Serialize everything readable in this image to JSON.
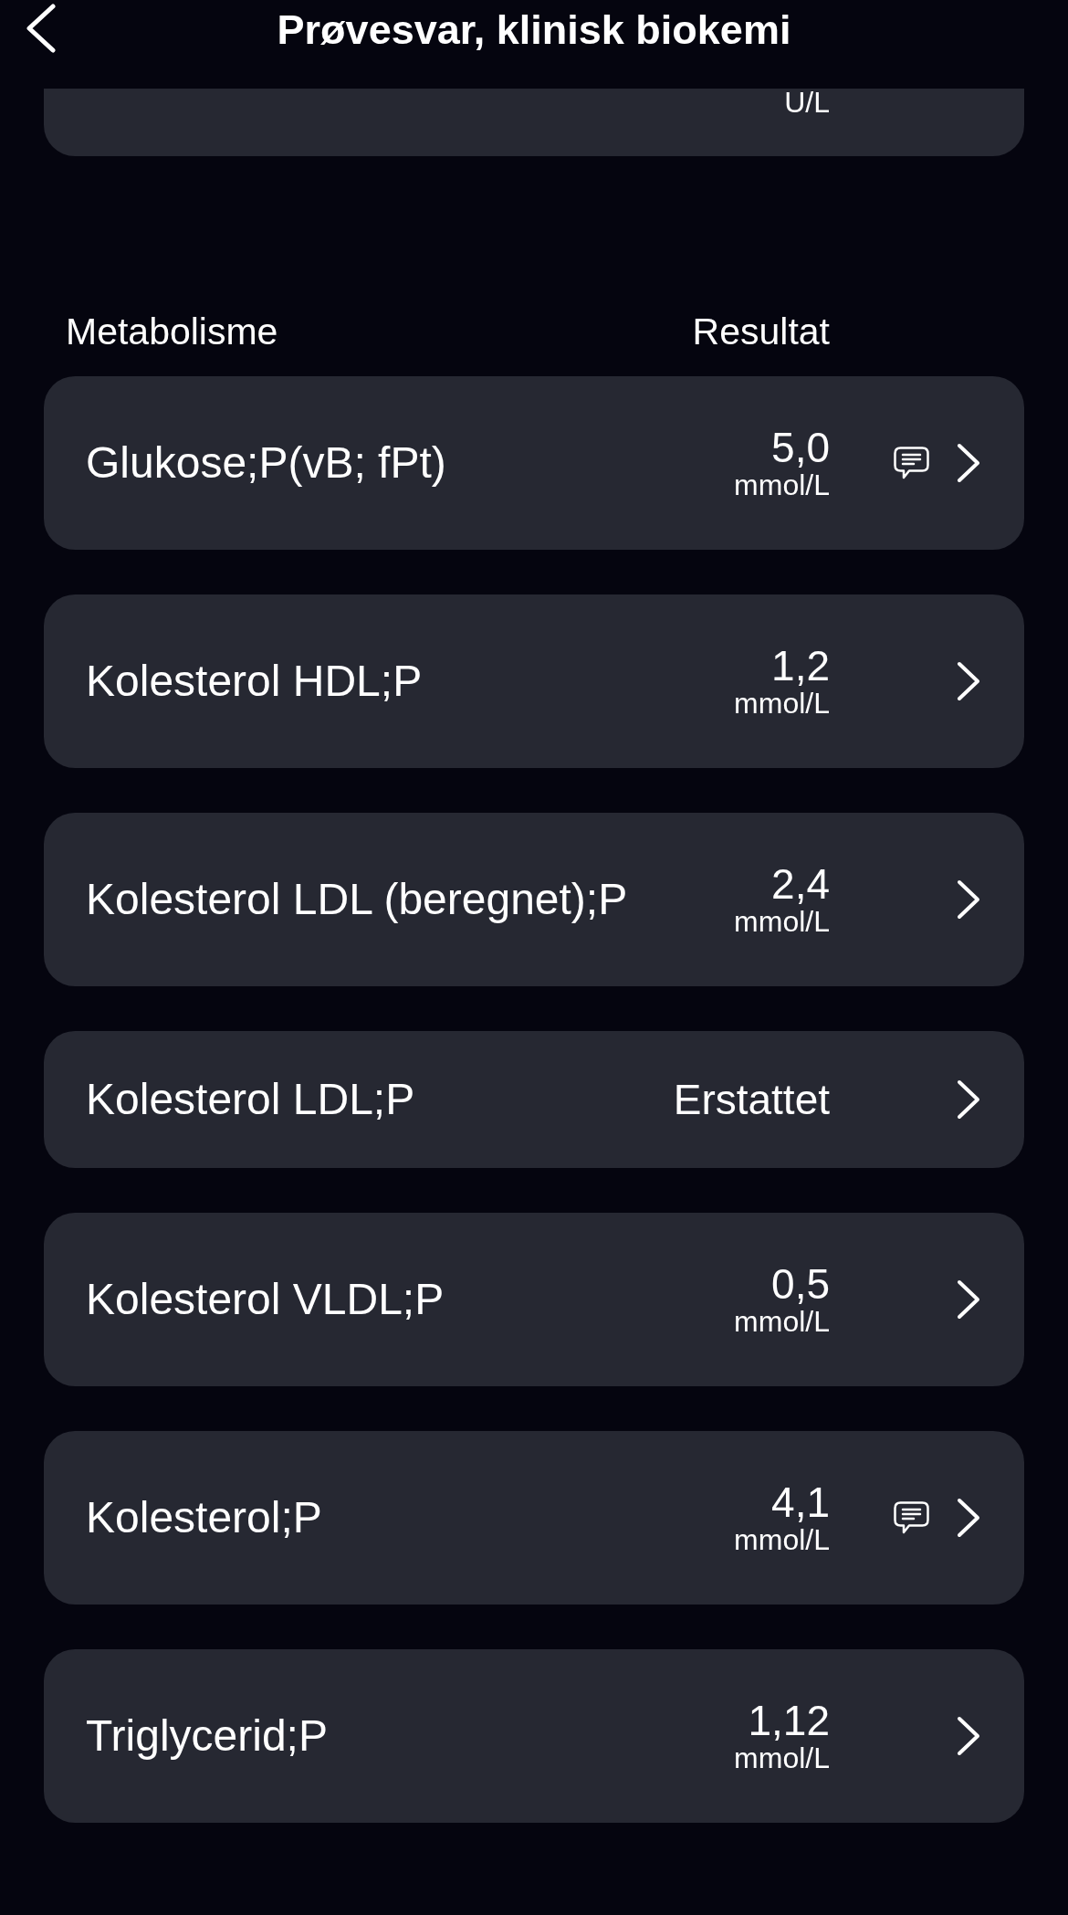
{
  "header": {
    "title": "Prøvesvar, klinisk biokemi"
  },
  "partial_card": {
    "unit": "U/L"
  },
  "section": {
    "label": "Metabolisme",
    "column_label": "Resultat"
  },
  "rows": [
    {
      "kind": "measurement",
      "name": "Glukose;P(vB; fPt)",
      "value": "5,0",
      "unit": "mmol/L",
      "has_comment": true
    },
    {
      "kind": "measurement",
      "name": "Kolesterol HDL;P",
      "value": "1,2",
      "unit": "mmol/L",
      "has_comment": false
    },
    {
      "kind": "measurement",
      "name": "Kolesterol LDL (beregnet);P",
      "value": "2,4",
      "unit": "mmol/L",
      "has_comment": false
    },
    {
      "kind": "status",
      "name": "Kolesterol LDL;P",
      "value": "Erstattet",
      "has_comment": false
    },
    {
      "kind": "measurement",
      "name": "Kolesterol VLDL;P",
      "value": "0,5",
      "unit": "mmol/L",
      "has_comment": false
    },
    {
      "kind": "measurement",
      "name": "Kolesterol;P",
      "value": "4,1",
      "unit": "mmol/L",
      "has_comment": true
    },
    {
      "kind": "measurement",
      "name": "Triglycerid;P",
      "value": "1,12",
      "unit": "mmol/L",
      "has_comment": false
    }
  ]
}
